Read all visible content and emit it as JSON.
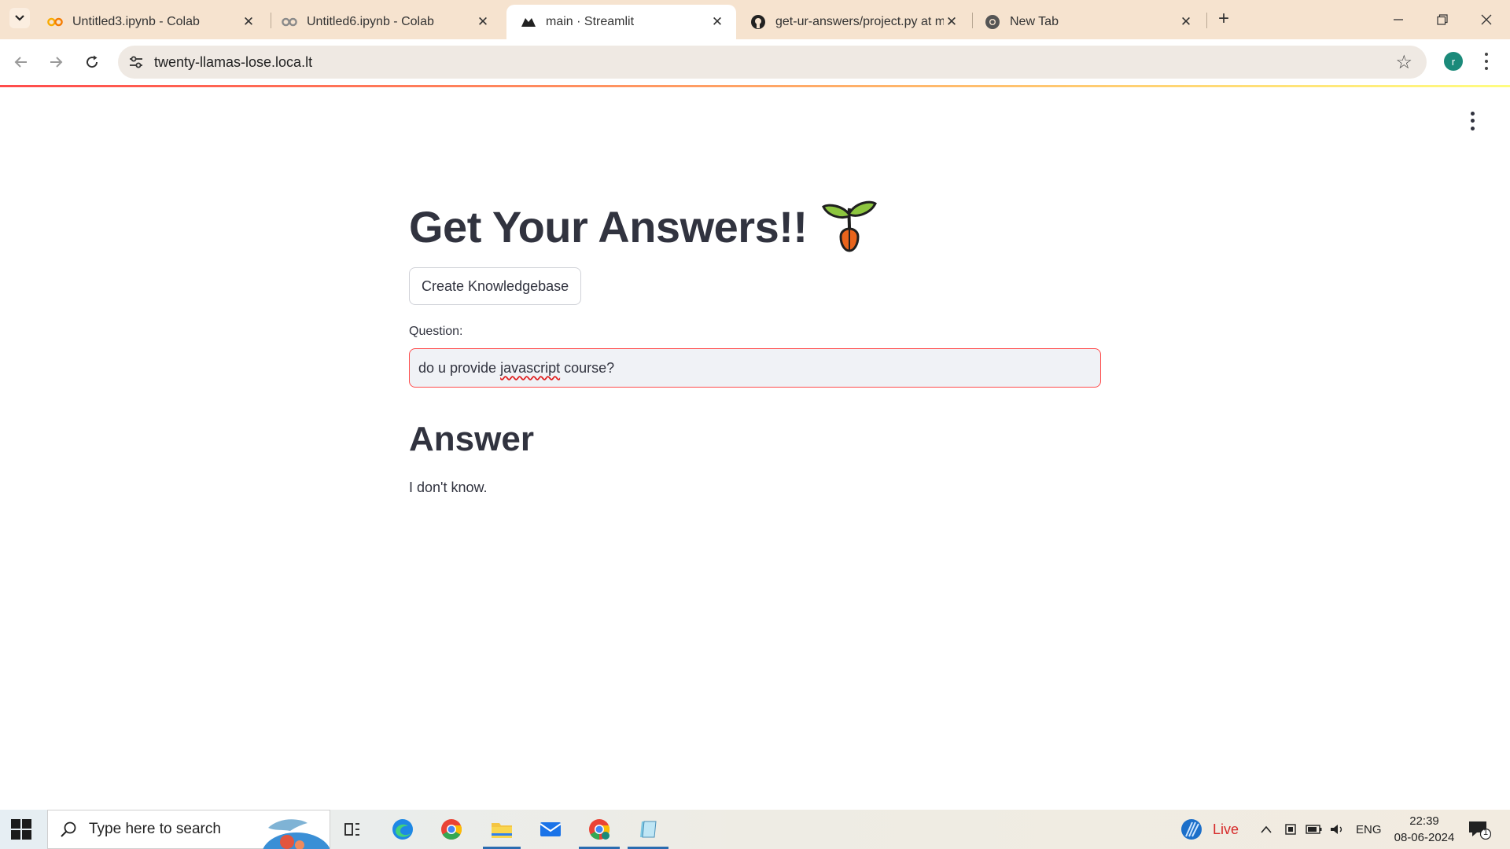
{
  "browser": {
    "tabs": [
      {
        "title": "Untitled3.ipynb - Colab",
        "icon": "colab-icon",
        "active": false
      },
      {
        "title": "Untitled6.ipynb - Colab",
        "icon": "colab-icon",
        "active": false
      },
      {
        "title": "main · Streamlit",
        "icon": "streamlit-icon",
        "active": true
      },
      {
        "title": "get-ur-answers/project.py at m",
        "icon": "github-icon",
        "active": false
      },
      {
        "title": "New Tab",
        "icon": "chrome-icon",
        "active": false
      }
    ],
    "close_glyph": "✕",
    "new_tab_glyph": "+",
    "url": "twenty-llamas-lose.loca.lt",
    "profile_initial": "r"
  },
  "page": {
    "title": "Get Your Answers!!",
    "title_emoji": "seedling-icon",
    "create_button": "Create Knowledgebase",
    "question_label": "Question:",
    "question_value": {
      "before": "do u provide ",
      "misspelled": "javascript",
      "after": " course?"
    },
    "answer_heading": "Answer",
    "answer_text": "I don't know."
  },
  "taskbar": {
    "search_placeholder": "Type here to search",
    "live_label": "Live",
    "language": "ENG",
    "time": "22:39",
    "date": "08-06-2024",
    "notification_count": "1"
  },
  "colors": {
    "streamlit_red": "#ff4b4b",
    "text": "#31333f",
    "tab_strip": "#f6e3cf"
  }
}
